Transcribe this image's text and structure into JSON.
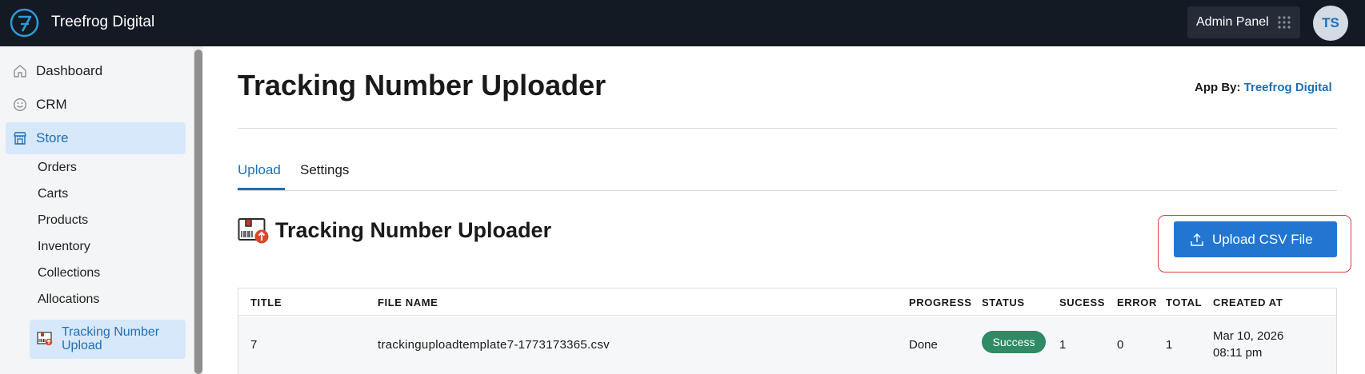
{
  "topbar": {
    "brand": "Treefrog Digital",
    "logo_icon": "treefrog-logo-icon",
    "admin_panel_label": "Admin Panel",
    "apps_icon": "grid-dots-icon",
    "avatar_initials": "TS"
  },
  "sidebar": {
    "items": [
      {
        "label": "Dashboard",
        "icon": "home-icon"
      },
      {
        "label": "CRM",
        "icon": "smiley-icon"
      },
      {
        "label": "Store",
        "icon": "storefront-icon"
      }
    ],
    "store_children": [
      "Orders",
      "Carts",
      "Products",
      "Inventory",
      "Collections",
      "Allocations"
    ],
    "active_child": {
      "label": "Tracking Number Upload",
      "icon": "tracking-uploader-icon"
    }
  },
  "main": {
    "page_title": "Tracking Number Uploader",
    "app_by_label": "App By:",
    "app_by_link": "Treefrog Digital",
    "tabs": [
      {
        "label": "Upload",
        "active": true
      },
      {
        "label": "Settings",
        "active": false
      }
    ],
    "section_title": "Tracking Number Uploader",
    "upload_button_label": "Upload CSV File"
  },
  "table": {
    "columns": [
      "TITLE",
      "FILE NAME",
      "PROGRESS",
      "STATUS",
      "SUCESS",
      "ERROR",
      "TOTAL",
      "CREATED AT"
    ],
    "rows": [
      {
        "title": "7",
        "file_name": "trackinguploadtemplate7-1773173365.csv",
        "progress": "Done",
        "status": "Success",
        "success": "1",
        "error": "0",
        "total": "1",
        "created_date": "Mar 10, 2026",
        "created_time": "08:11 pm"
      }
    ]
  },
  "colors": {
    "topbar_bg": "#141a24",
    "accent": "#1f6fb5",
    "button_bg": "#2276d2",
    "success_badge": "#2e8b63",
    "highlight_border": "#e23b3b",
    "sidebar_active_bg": "#d7e8fa"
  }
}
